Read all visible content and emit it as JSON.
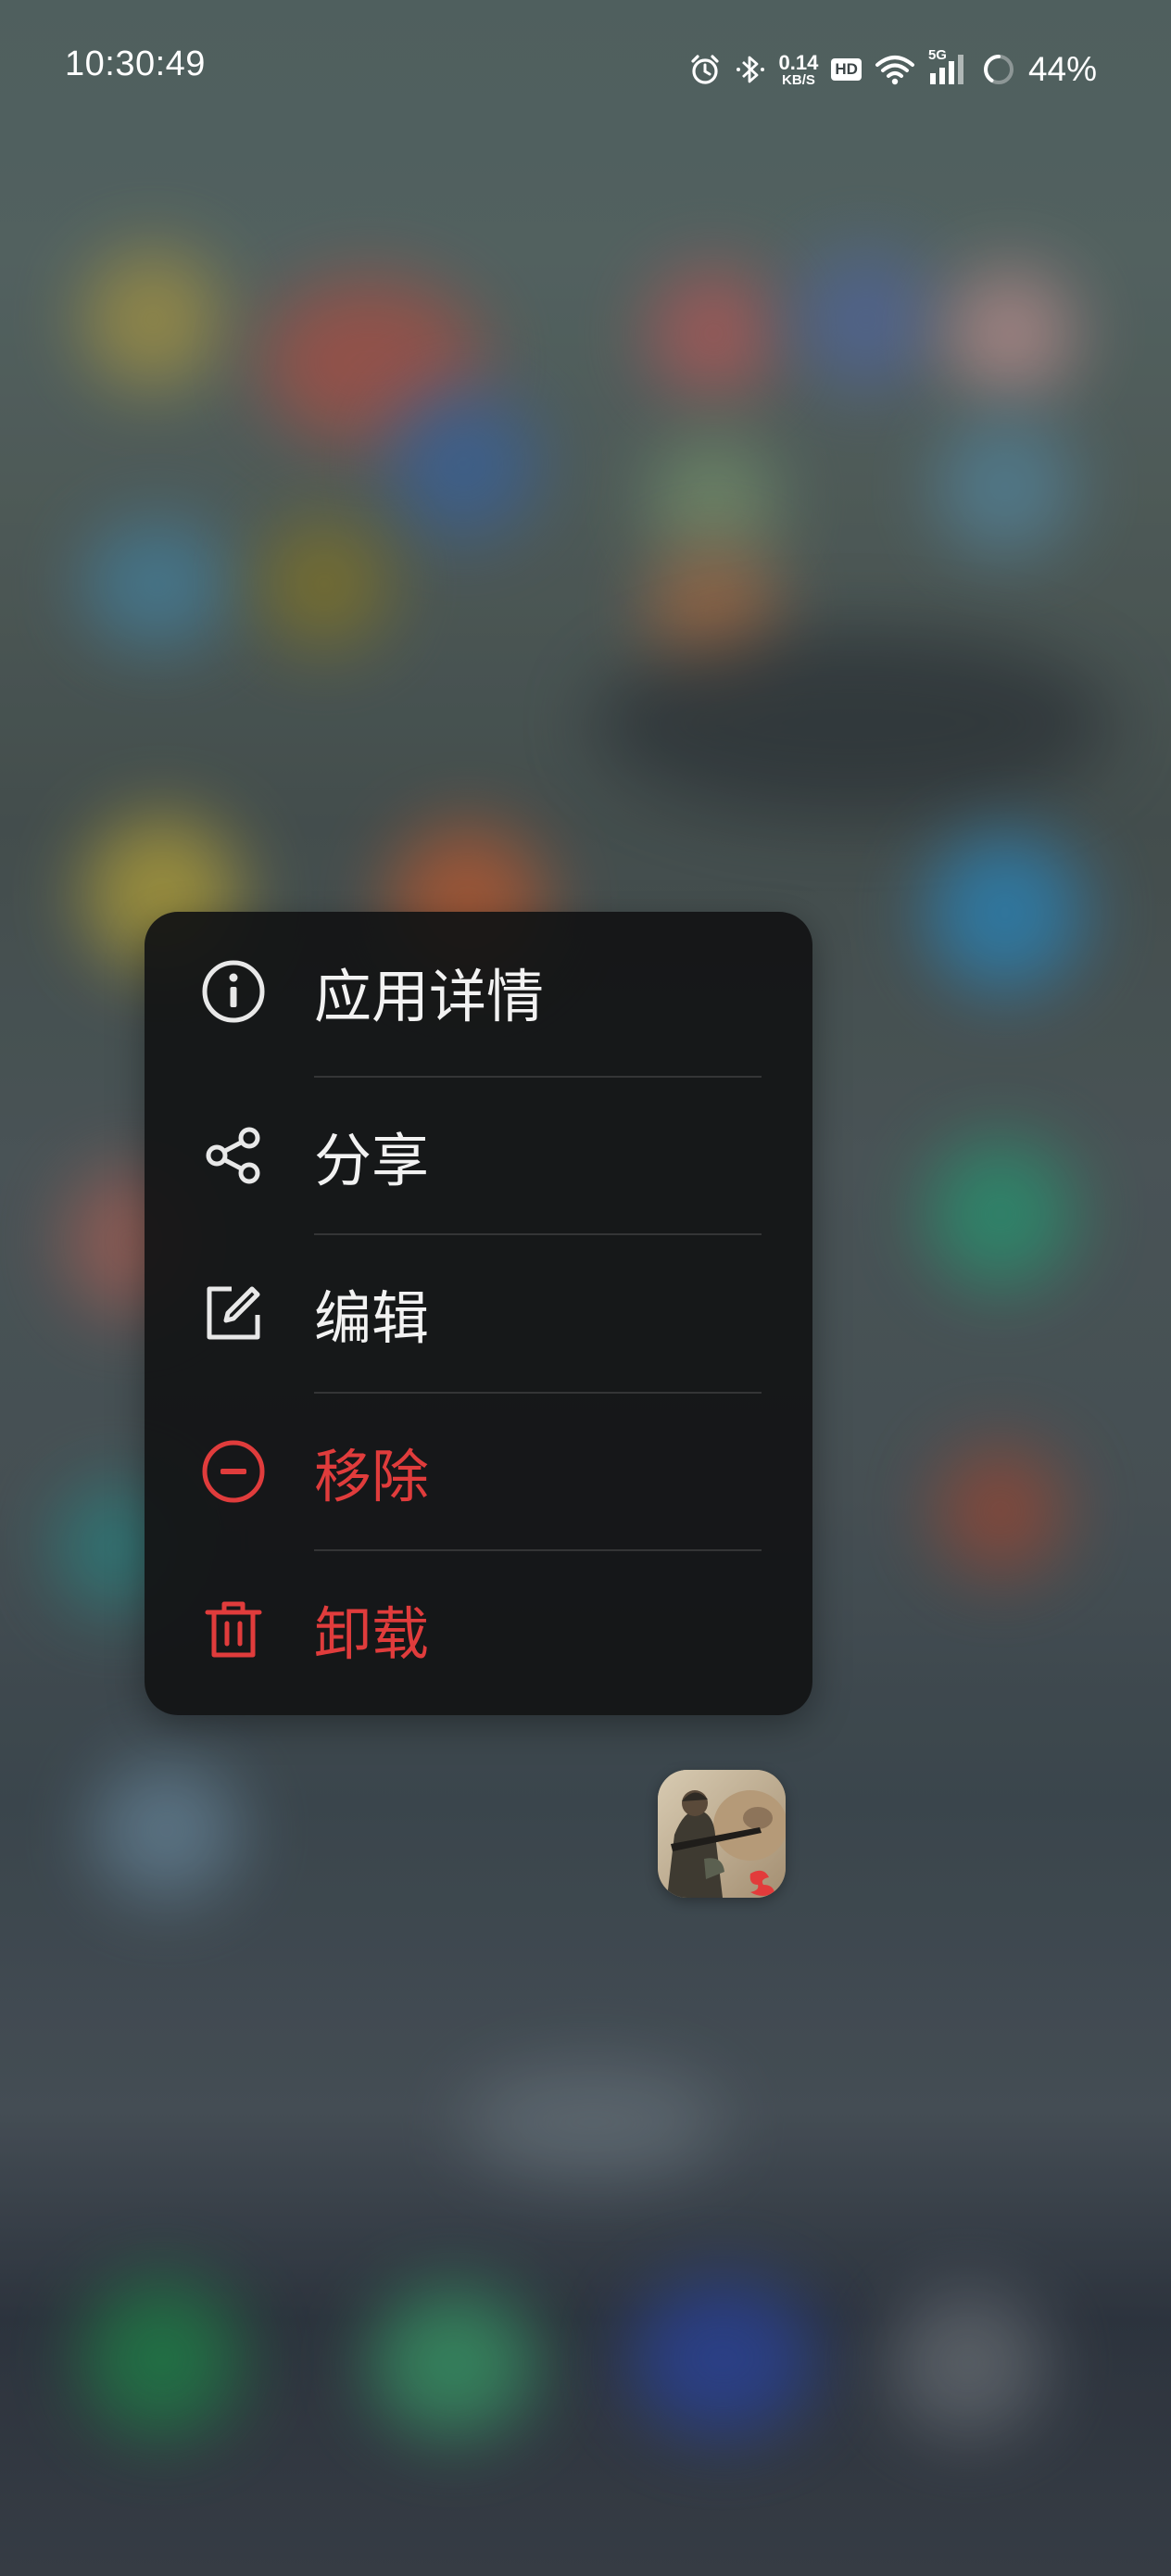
{
  "status_bar": {
    "time": "10:30:49",
    "net_speed_value": "0.14",
    "net_speed_unit": "KB/S",
    "hd_label": "HD",
    "network_label": "5G",
    "battery_percent": "44%"
  },
  "context_menu": {
    "items": [
      {
        "label": "应用详情",
        "icon": "info-icon",
        "danger": false
      },
      {
        "label": "分享",
        "icon": "share-icon",
        "danger": false
      },
      {
        "label": "编辑",
        "icon": "edit-icon",
        "danger": false
      },
      {
        "label": "移除",
        "icon": "remove-icon",
        "danger": true
      },
      {
        "label": "卸载",
        "icon": "trash-icon",
        "danger": true
      }
    ]
  },
  "colors": {
    "danger": "#e03c3c",
    "menu_background": "#121314",
    "menu_text": "#f2f2f2"
  }
}
